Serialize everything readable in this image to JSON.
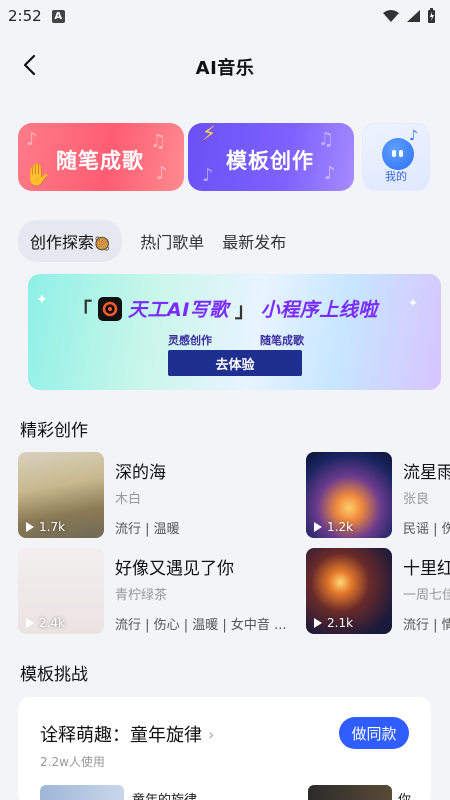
{
  "status": {
    "time": "2:52",
    "badge": "A"
  },
  "header": {
    "title": "AI音乐"
  },
  "entries": [
    {
      "label": "随笔成歌"
    },
    {
      "label": "模板创作"
    },
    {
      "label": "我的"
    }
  ],
  "tabs": [
    {
      "label": "创作探索",
      "active": true
    },
    {
      "label": "热门歌单",
      "active": false
    },
    {
      "label": "最新发布",
      "active": false
    }
  ],
  "banner": {
    "title": "天工AI写歌",
    "title_suffix": "小程序上线啦",
    "left_bracket": "「",
    "right_bracket": "」",
    "sub1": "灵感创作",
    "sub2": "随笔成歌",
    "button": "去体验"
  },
  "sections": {
    "works": "精彩创作",
    "challenge": "模板挑战"
  },
  "works": [
    {
      "name": "深的海",
      "artist": "木白",
      "tags": "流行 | 温暖",
      "plays": "1.7k"
    },
    {
      "name": "流星雨",
      "artist": "张良",
      "tags": "民谣 | 伤",
      "plays": "1.2k"
    },
    {
      "name": "好像又遇见了你",
      "artist": "青柠绿茶",
      "tags": "流行 | 伤心 | 温暖 | 女中音 ...",
      "plays": "2.4k"
    },
    {
      "name": "十里红",
      "artist": "一周七佳",
      "tags": "流行 | 情",
      "plays": "2.1k"
    }
  ],
  "challenge": {
    "title": "诠释萌趣：童年旋律",
    "users": "2.2w人使用",
    "button": "做同款",
    "peek1": "童年的旋律",
    "peek2": "你"
  }
}
